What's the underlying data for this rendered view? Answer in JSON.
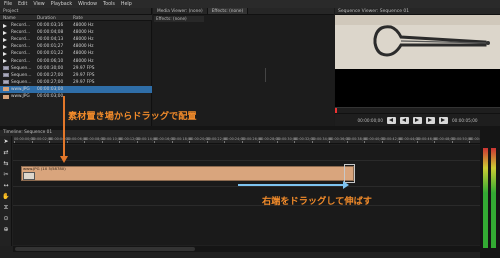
{
  "menu": [
    "File",
    "Edit",
    "View",
    "Playback",
    "Window",
    "Tools",
    "Help"
  ],
  "project": {
    "title": "Project",
    "columns": [
      "Name",
      "Duration",
      "Rate"
    ],
    "rows": [
      {
        "icon": "audio",
        "name": "Record…",
        "duration": "00:00:03;16",
        "rate": "48000 Hz"
      },
      {
        "icon": "audio",
        "name": "Record…",
        "duration": "00:00:04;08",
        "rate": "48000 Hz"
      },
      {
        "icon": "audio",
        "name": "Record…",
        "duration": "00:00:04;13",
        "rate": "48000 Hz"
      },
      {
        "icon": "audio",
        "name": "Record…",
        "duration": "00:00:01;27",
        "rate": "48000 Hz"
      },
      {
        "icon": "audio",
        "name": "Record…",
        "duration": "00:00:01;22",
        "rate": "48000 Hz"
      },
      {
        "icon": "audio",
        "name": "Record…",
        "duration": "00:00:06;10",
        "rate": "48000 Hz"
      },
      {
        "icon": "seq",
        "name": "Sequen…",
        "duration": "00:00:30;00",
        "rate": "29.97 FPS"
      },
      {
        "icon": "seq",
        "name": "Sequen…",
        "duration": "00:00:27;00",
        "rate": "29.97 FPS"
      },
      {
        "icon": "seq",
        "name": "Sequen…",
        "duration": "00:00:27;00",
        "rate": "29.97 FPS"
      },
      {
        "icon": "img",
        "name": "www.JPG",
        "duration": "00:00:03;00",
        "rate": ""
      },
      {
        "icon": "img",
        "name": "www.JPG",
        "duration": "00:00:03;00",
        "rate": ""
      }
    ]
  },
  "media_viewer": {
    "tabs": [
      "Media Viewer: (none)",
      "Effects: (none)"
    ],
    "effects_label": "Effects: (none)"
  },
  "sequence_viewer": {
    "title": "Sequence Viewer: Sequence 01",
    "timecode_left": "00:00:00;00",
    "timecode_right": "00:00:05;00"
  },
  "timeline": {
    "title": "Timeline: Sequence 01",
    "clip_label": "www.JPG (1X 5/58780)"
  },
  "annotations": {
    "drag_from_bin": "素材置き場からドラッグで配置",
    "drag_right_edge": "右端をドラッグして伸ばす"
  },
  "colors": {
    "selection": "#2f6ea8",
    "clip": "#d9a57d",
    "annotation": "#f08a2a",
    "arrow_blue": "#7dc3f0"
  }
}
